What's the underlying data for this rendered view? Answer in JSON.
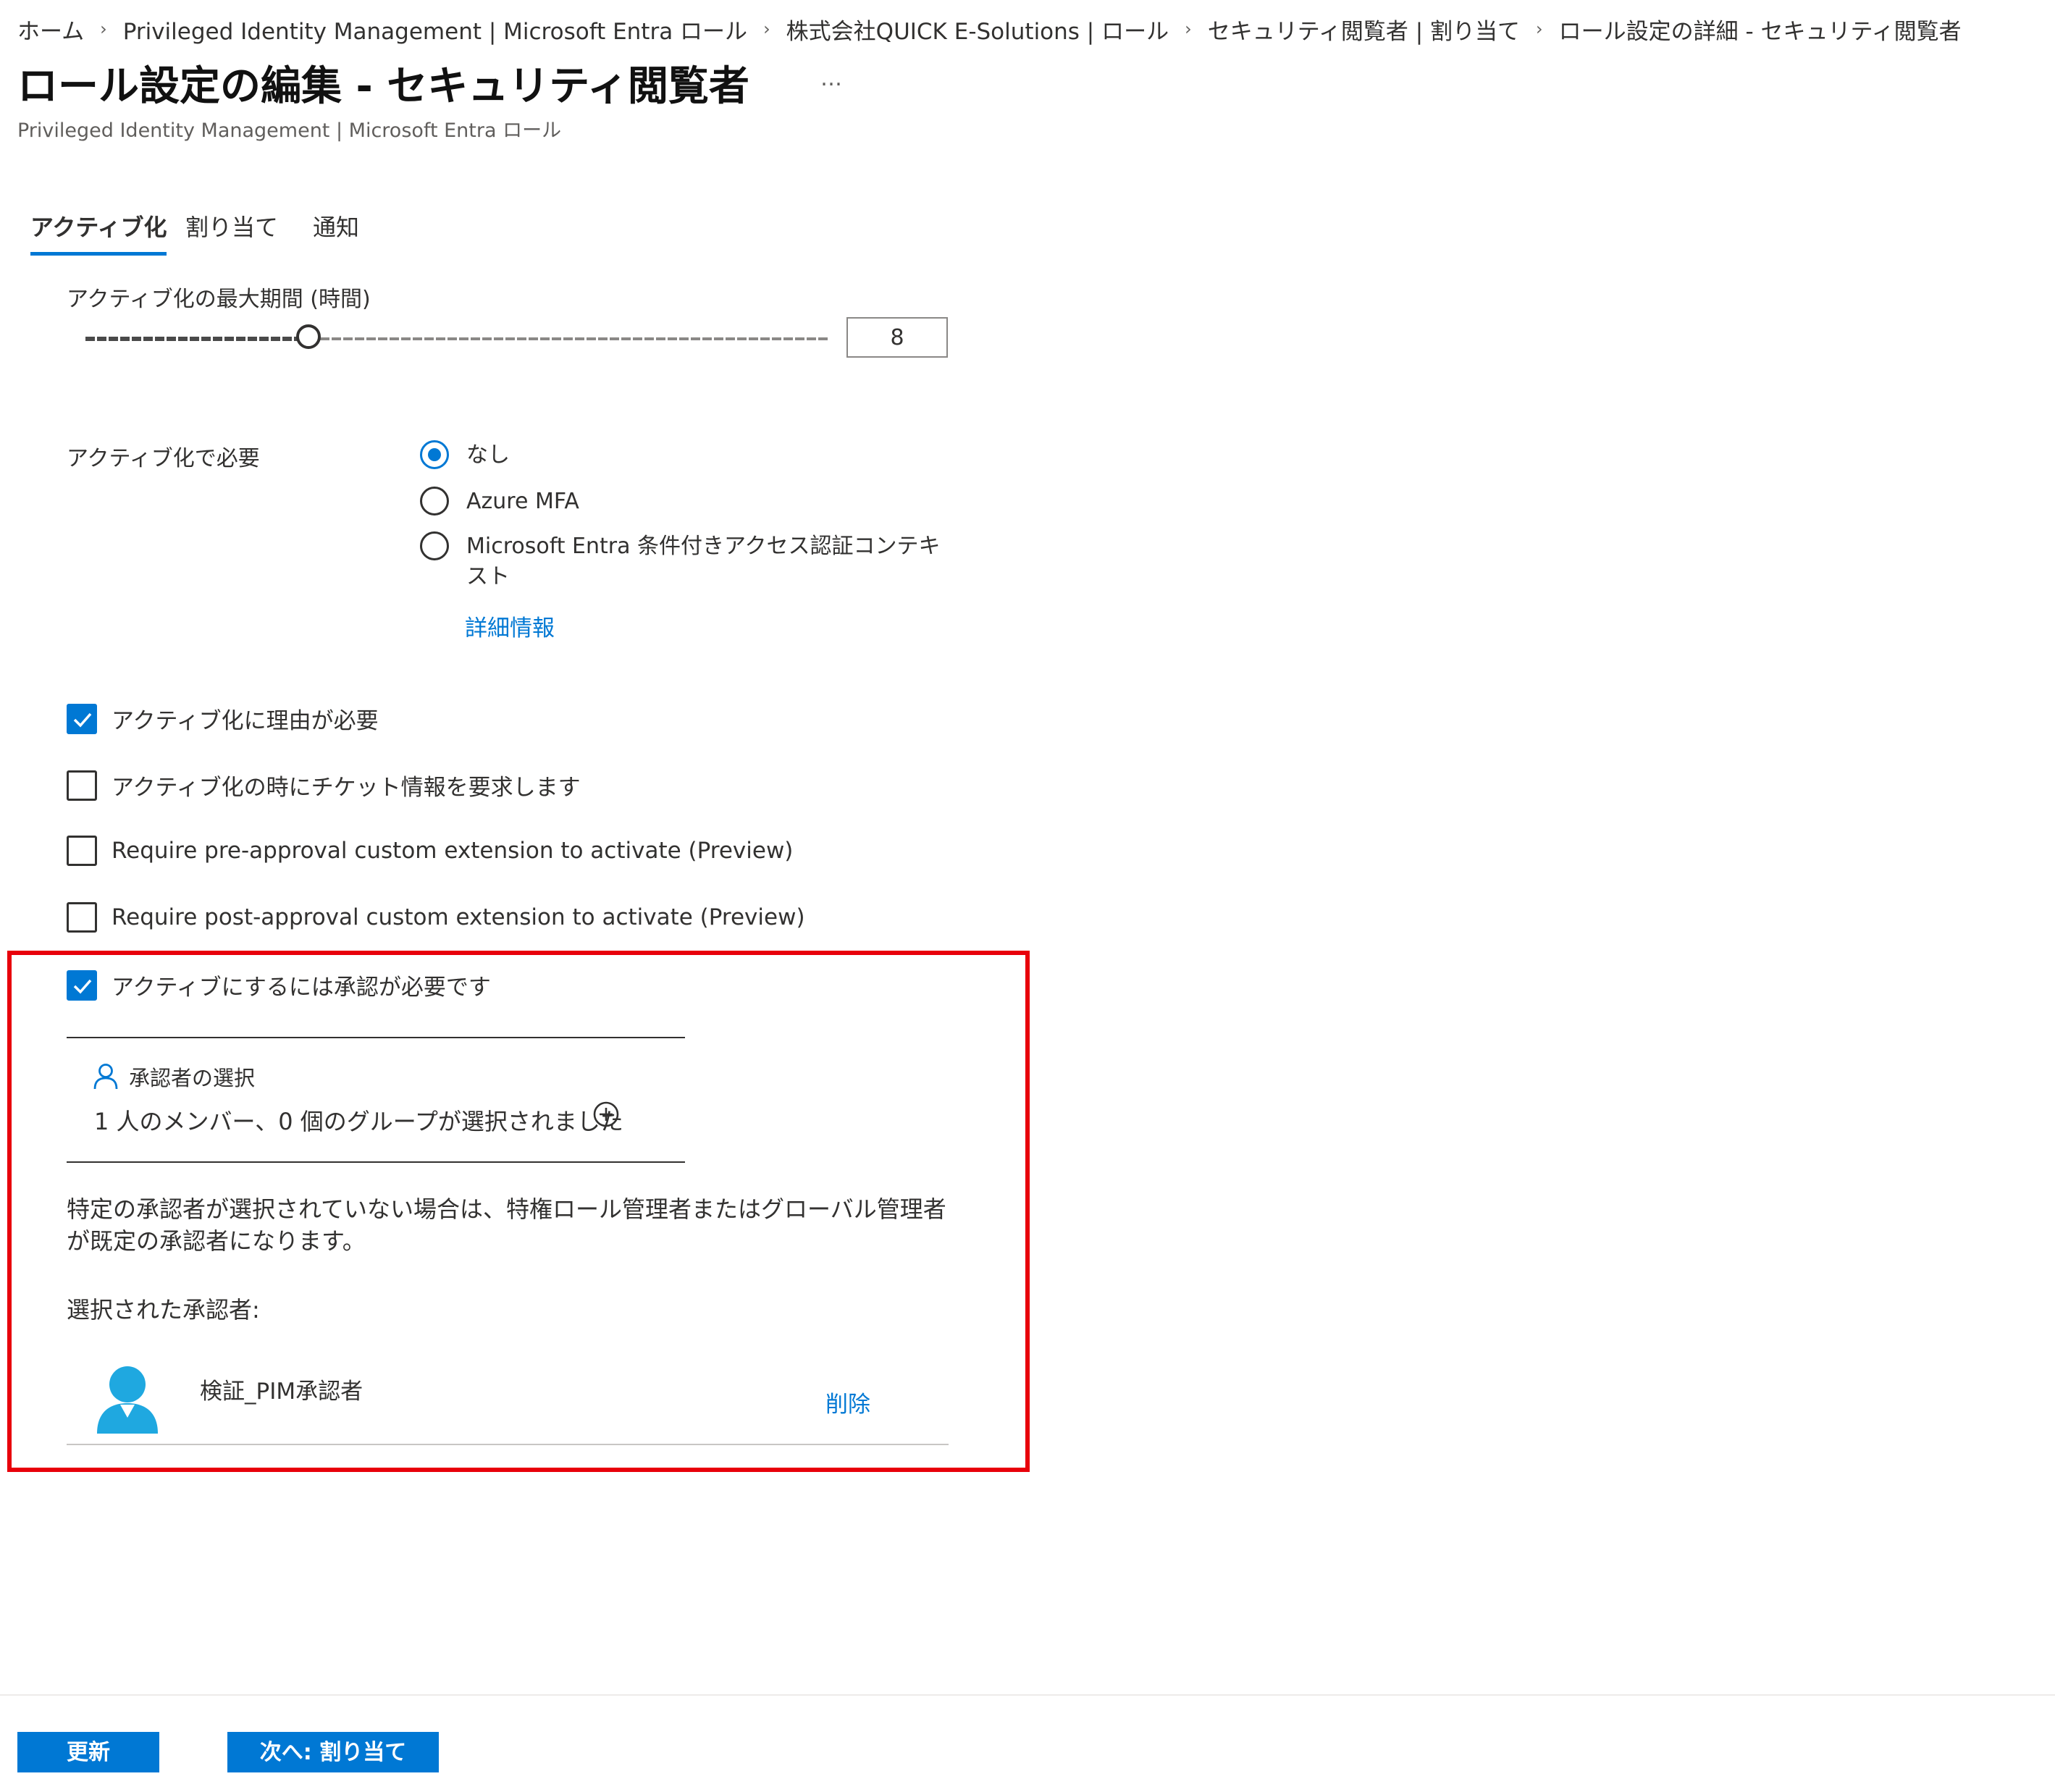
{
  "breadcrumb": [
    "ホーム",
    "Privileged Identity Management | Microsoft Entra ロール",
    "株式会社QUICK E-Solutions | ロール",
    "セキュリティ閲覧者 | 割り当て",
    "ロール設定の詳細 - セキュリティ閲覧者"
  ],
  "breadcrumb_separator": "›",
  "page": {
    "title": "ロール設定の編集 - セキュリティ閲覧者",
    "more": "…",
    "subtitle": "Privileged Identity Management | Microsoft Entra ロール"
  },
  "tabs": [
    {
      "label": "アクティブ化",
      "active": true
    },
    {
      "label": "割り当て",
      "active": false
    },
    {
      "label": "通知",
      "active": false
    }
  ],
  "activation": {
    "max_duration_label": "アクティブ化の最大期間 (時間)",
    "max_duration_value": "8",
    "slider_fraction": 0.3,
    "require_label": "アクティブ化で必要",
    "require_options": [
      {
        "label": "なし",
        "selected": true
      },
      {
        "label": "Azure MFA",
        "selected": false
      },
      {
        "label": "Microsoft Entra 条件付きアクセス認証コンテキスト",
        "selected": false
      }
    ],
    "more_info_link": "詳細情報",
    "checkboxes": [
      {
        "label": "アクティブ化に理由が必要",
        "checked": true
      },
      {
        "label": "アクティブ化の時にチケット情報を要求します",
        "checked": false
      },
      {
        "label": "Require pre-approval custom extension to activate (Preview)",
        "checked": false
      },
      {
        "label": "Require post-approval custom extension to activate (Preview)",
        "checked": false
      },
      {
        "label": "アクティブにするには承認が必要です",
        "checked": true
      }
    ]
  },
  "approval": {
    "select_approvers_label": "承認者の選択",
    "members_summary": "1 人のメンバー、0 個のグループが選択されました",
    "note": "特定の承認者が選択されていない場合は、特権ロール管理者またはグローバル管理者が既定の承認者になります。",
    "selected_label": "選択された承認者:",
    "approvers": [
      {
        "name": "検証_PIM承認者",
        "remove_label": "削除"
      }
    ]
  },
  "footer": {
    "update_button": "更新",
    "next_button": "次へ: 割り当て"
  },
  "colors": {
    "accent": "#0078d4",
    "highlight_border": "#e8000b",
    "avatar": "#1fa8e0"
  },
  "icons": [
    "person-icon",
    "add-circle-icon",
    "checkmark-icon",
    "user-avatar-icon"
  ]
}
